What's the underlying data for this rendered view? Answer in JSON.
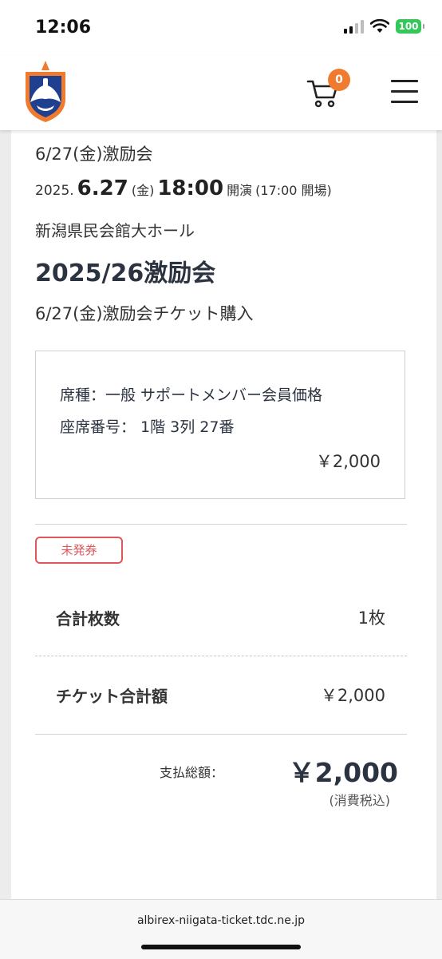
{
  "status_bar": {
    "time": "12:06",
    "battery": "100"
  },
  "header": {
    "cart_count": "0",
    "logo": "albirex-niigata-crest",
    "cart_icon": "cart-icon",
    "menu_icon": "hamburger-menu-icon"
  },
  "event": {
    "name_top": "6/27(金)激励会",
    "date": {
      "year": "2025.",
      "month_day": "6.27",
      "weekday": "(金)",
      "start_time": "18:00",
      "start_label": "開演",
      "open_info": "(17:00 開場)"
    },
    "venue": "新潟県民会館大ホール",
    "title": "2025/26激励会",
    "purchase_title": "6/27(金)激励会チケット購入"
  },
  "seat": {
    "type": "席種：一般 サポートメンバー会員価格",
    "number": "座席番号： 1階 3列 27番",
    "price": "￥2,000"
  },
  "status_badge": "未発券",
  "summary": {
    "count_label": "合計枚数",
    "count_value": "1枚",
    "ticket_total_label": "チケット合計額",
    "ticket_total_value": "￥2,000",
    "payment_label": "支払総額：",
    "payment_value": "￥2,000",
    "tax_note": "(消費税込)"
  },
  "browser": {
    "url": "albirex-niigata-ticket.tdc.ne.jp"
  },
  "colors": {
    "accent": "#f07a2e",
    "badge_red": "#e0575b",
    "text_dark": "#2b3340",
    "battery_green": "#34c759"
  }
}
